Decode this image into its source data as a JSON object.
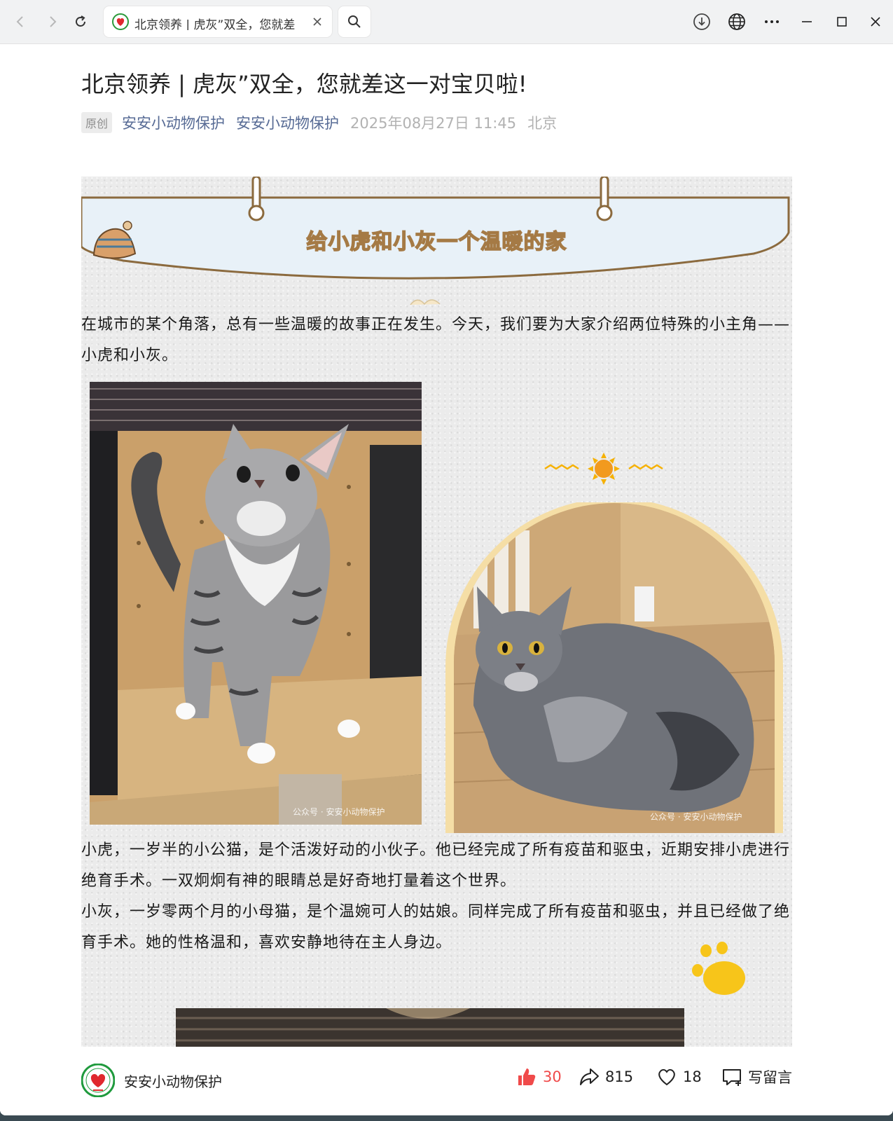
{
  "browser": {
    "tab_title": "北京领养 | 虎灰”双全，您就差",
    "icons": [
      "back-icon",
      "forward-icon",
      "reload-icon",
      "favicon",
      "close-icon",
      "search-icon",
      "download-icon",
      "globe-icon",
      "more-icon",
      "minimize-icon",
      "maximize-icon",
      "window-close-icon"
    ]
  },
  "article": {
    "title": "北京领养 | 虎灰”双全，您就差这一对宝贝啦!",
    "badge": "原创",
    "author1": "安安小动物保护",
    "author2": "安安小动物保护",
    "datetime": "2025年08月27日 11:45",
    "location": "北京",
    "banner_text": "给小虎和小灰一个温暖的家",
    "intro": "在城市的某个角落，总有一些温暖的故事正在发生。今天，我们要为大家介绍两位特殊的小主角——小虎和小灰。",
    "para_tiger": "小虎，一岁半的小公猫，是个活泼好动的小伙子。他已经完成了所有疫苗和驱虫，近期安排小虎进行绝育手术。一双炯炯有神的眼睛总是好奇地打量着这个世界。",
    "para_grey": "小灰，一岁零两个月的小母猫，是个温婉可人的姑娘。同样完成了所有疫苗和驱虫，并且已经做了绝育手术。她的性格温和，喜欢安静地待在主人身边。",
    "watermark1": "公众号 · 安安小动物保护",
    "watermark2": "公众号 · 安安小动物保护"
  },
  "bottom": {
    "account": "安安小动物保护",
    "likes": "30",
    "shares": "815",
    "favorites": "18",
    "comment_label": "写留言"
  },
  "colors": {
    "link": "#576b95",
    "like_red": "#f04a4a",
    "banner_fill": "#e8f1f8",
    "banner_stroke": "#8b6a3e",
    "sun": "#f6b100",
    "paw": "#f7c51a"
  }
}
